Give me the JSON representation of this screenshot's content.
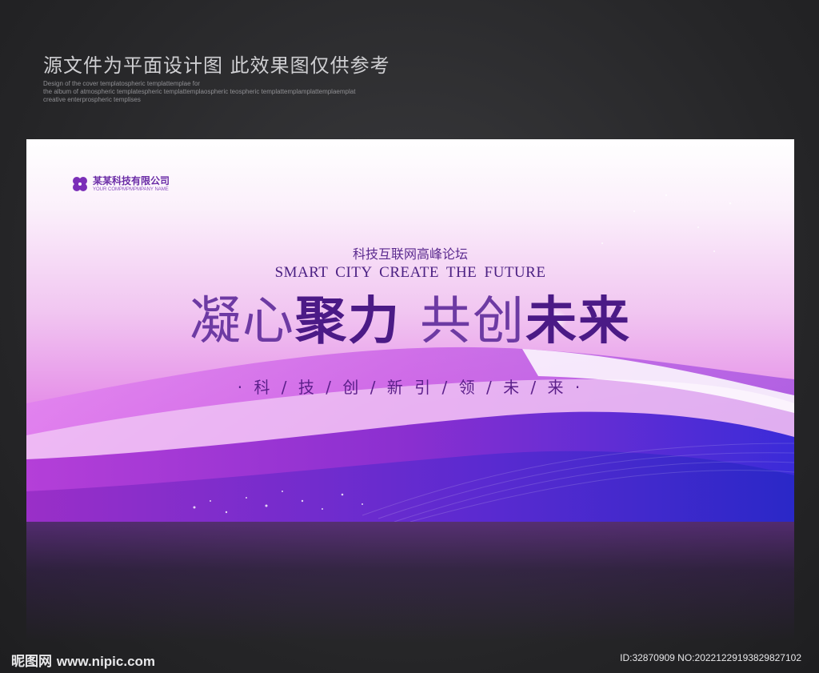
{
  "header": {
    "title": "源文件为平面设计图 此效果图仅供参考",
    "desc_lines": [
      "Design of the cover templatospheric templattemplae for",
      "the album of atmospheric templatespheric templattemplaospheric teospheric templattemplamplattemplaemplat",
      "creative enterprospheric templises"
    ]
  },
  "board": {
    "logo": {
      "name": "某某科技有限公司",
      "sub": "YOUR COMPMPMPMPANY NAME",
      "icon": "four-leaf-clover-icon"
    },
    "forum": "科技互联网高峰论坛",
    "en_title": "SMART CITY  CREATE THE FUTURE",
    "main_title": {
      "part1_light": "凝心",
      "part1_bold": "聚力",
      "part2_light": "共创",
      "part2_bold": "未来"
    },
    "slogan": "· 科 / 技 / 创 / 新   引 / 领 / 未 / 来 ·"
  },
  "footer": {
    "brand": "昵图网",
    "url": "www.nipic.com",
    "id_text": "ID:32870909 NO:20221229193829827102"
  },
  "colors": {
    "accent_purple": "#6a2ba6",
    "deep_purple": "#4b1a86",
    "blue_wave": "#3a2bd8",
    "background": "#2a2a2c"
  }
}
